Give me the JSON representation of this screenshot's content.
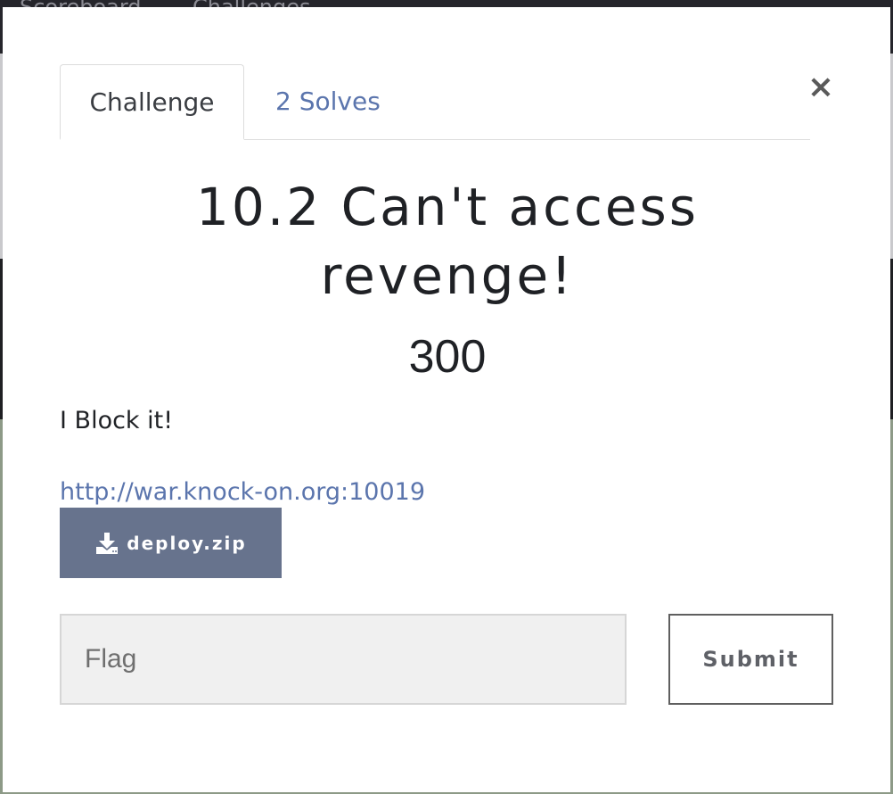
{
  "backdrop": {
    "nav_items": [
      "Scoreboard",
      "Challenges"
    ]
  },
  "modal": {
    "tabs": [
      {
        "label": "Challenge",
        "active": true
      },
      {
        "label": "2 Solves",
        "active": false
      }
    ],
    "close_glyph": "×",
    "title": "10.2 Can't access revenge!",
    "points": "300",
    "description": "I Block it!",
    "link_text": "http://war.knock-on.org:10019",
    "file_button": {
      "label": "deploy.zip",
      "icon": "download-icon"
    },
    "flag_input": {
      "placeholder": "Flag",
      "value": ""
    },
    "submit_label": "Submit"
  },
  "colors": {
    "accent_link": "#5b75ad",
    "file_button_bg": "#67738d",
    "input_bg": "#f0f0f0"
  }
}
